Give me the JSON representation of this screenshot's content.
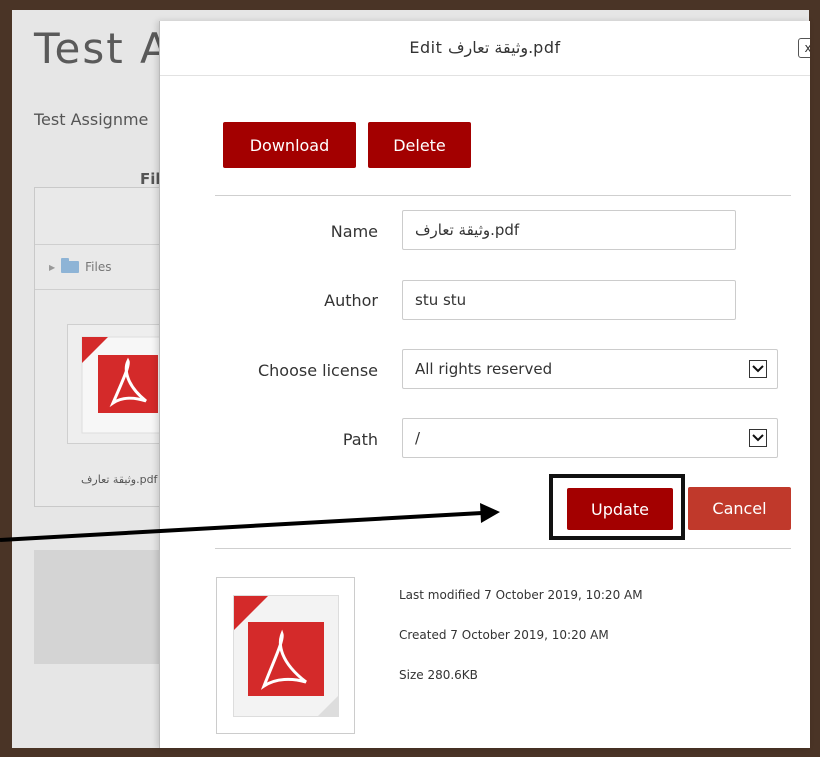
{
  "background": {
    "title": "Test A",
    "subtitle": "Test Assignme",
    "files_label": "File",
    "path_folder": "Files",
    "filename": "وثيقة تعارف.pdf"
  },
  "modal": {
    "title": "Edit وثيقة تعارف.pdf",
    "close_label": "x",
    "download_label": "Download",
    "delete_label": "Delete",
    "fields": {
      "name_label": "Name",
      "name_value": "وثيقة تعارف.pdf",
      "author_label": "Author",
      "author_value": "stu stu",
      "license_label": "Choose license",
      "license_value": "All rights reserved",
      "path_label": "Path",
      "path_value": "/"
    },
    "update_label": "Update",
    "cancel_label": "Cancel",
    "meta": {
      "last_modified": "Last modified  7 October 2019, 10:20 AM",
      "created": "Created  7 October 2019, 10:20 AM",
      "size": "Size  280.6KB"
    }
  },
  "colors": {
    "primary_button": "#a30000",
    "cancel_button": "#c0392b",
    "pdf_red": "#d42a2a"
  }
}
